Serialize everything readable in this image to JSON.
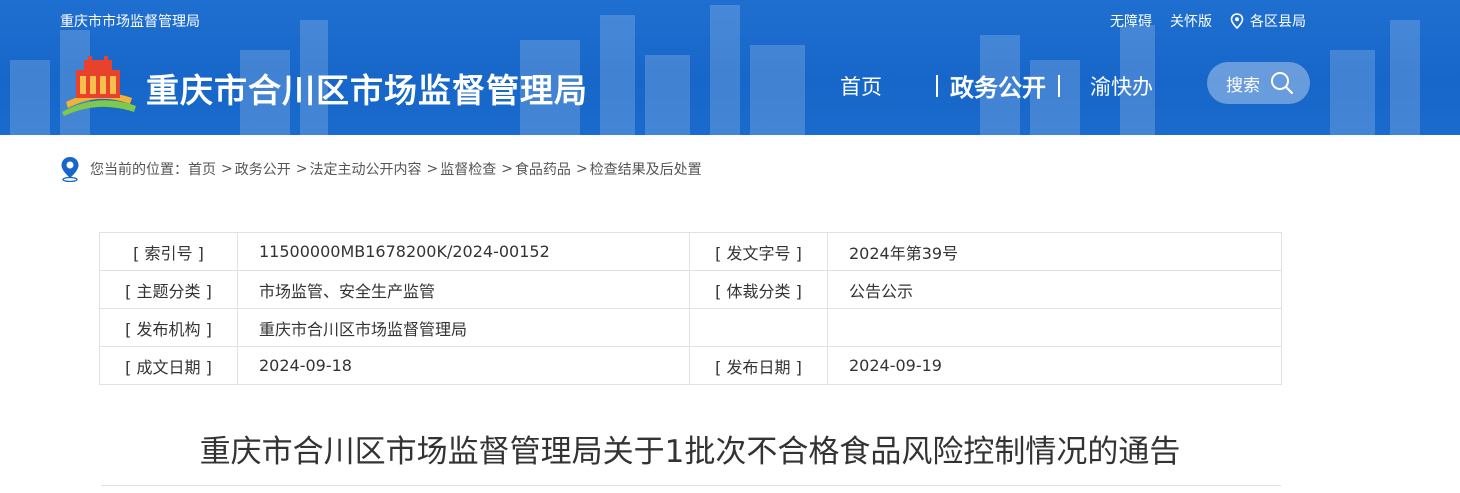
{
  "header": {
    "site_name_small": "重庆市市场监督管理局",
    "site_title": "重庆市合川区市场监督管理局",
    "top_links": {
      "accessibility": "无障碍",
      "elderly": "关怀版",
      "districts": "各区县局"
    },
    "nav": {
      "home": "首页",
      "gov_open": "政务公开",
      "yu_kuai_ban": "渝快办"
    },
    "search_label": "搜索",
    "accent_color": "#1766c9"
  },
  "breadcrumb": {
    "prefix": "您当前的位置：",
    "items": [
      "首页",
      "政务公开",
      "法定主动公开内容",
      "监督检查",
      "食品药品",
      "检查结果及后处置"
    ],
    "separator": ">"
  },
  "meta": {
    "index_no_label": "[ 索引号 ]",
    "index_no": "11500000MB1678200K/2024-00152",
    "doc_no_label": "[ 发文字号 ]",
    "doc_no": "2024年第39号",
    "topic_label": "[ 主题分类 ]",
    "topic": "市场监管、安全生产监管",
    "genre_label": "[ 体裁分类 ]",
    "genre": "公告公示",
    "issuer_label": "[ 发布机构 ]",
    "issuer": "重庆市合川区市场监督管理局",
    "created_label": "[ 成文日期 ]",
    "created": "2024-09-18",
    "published_label": "[ 发布日期 ]",
    "published": "2024-09-19"
  },
  "article": {
    "title": "重庆市合川区市场监督管理局关于1批次不合格食品风险控制情况的通告"
  }
}
